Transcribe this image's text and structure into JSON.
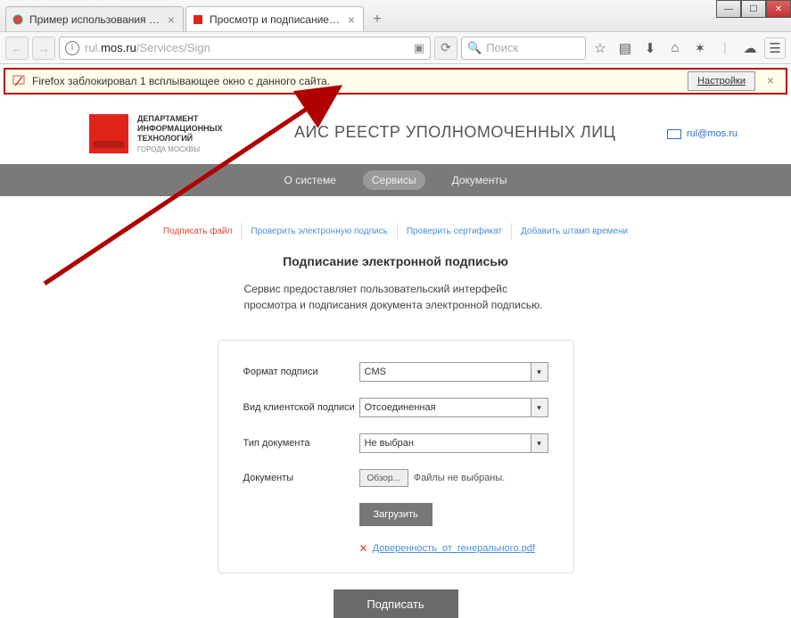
{
  "window": {
    "tabs": [
      {
        "title": "Пример использования К...",
        "active": false
      },
      {
        "title": "Просмотр и подписание ...",
        "active": true
      }
    ]
  },
  "urlbar": {
    "url": "rul.mos.ru/Services/Sign"
  },
  "search": {
    "placeholder": "Поиск"
  },
  "popup": {
    "message": "Firefox заблокировал 1 всплывающее окно с данного сайта.",
    "settings": "Настройки"
  },
  "header": {
    "logo_line1": "ДЕПАРТАМЕНТ",
    "logo_line2": "ИНФОРМАЦИОННЫХ",
    "logo_line3": "ТЕХНОЛОГИЙ",
    "logo_sub": "ГОРОДА МОСКВЫ",
    "site_title": "АИС РЕЕСТР УПОЛНОМОЧЕННЫХ ЛИЦ",
    "email": "rul@mos.ru"
  },
  "nav": {
    "items": [
      "О системе",
      "Сервисы",
      "Документы"
    ]
  },
  "subtabs": {
    "items": [
      "Подписать файл",
      "Проверить электронную подпись",
      "Проверить сертификат",
      "Добавить штамп времени"
    ]
  },
  "content": {
    "title": "Подписание электронной подписью",
    "desc": "Сервис предоставляет пользовательский интерфейс просмотра и подписания документа электронной подписью."
  },
  "form": {
    "format_label": "Формат подписи",
    "format_value": "CMS",
    "client_label": "Вид клиентской подписи",
    "client_value": "Отсоединенная",
    "doctype_label": "Тип документа",
    "doctype_value": "Не выбран",
    "docs_label": "Документы",
    "browse_btn": "Обзор...",
    "nofiles": "Файлы не выбраны.",
    "upload_btn": "Загрузить",
    "file_link": "Доверенность_от_генерального.pdf",
    "sign_btn": "Подписать"
  }
}
